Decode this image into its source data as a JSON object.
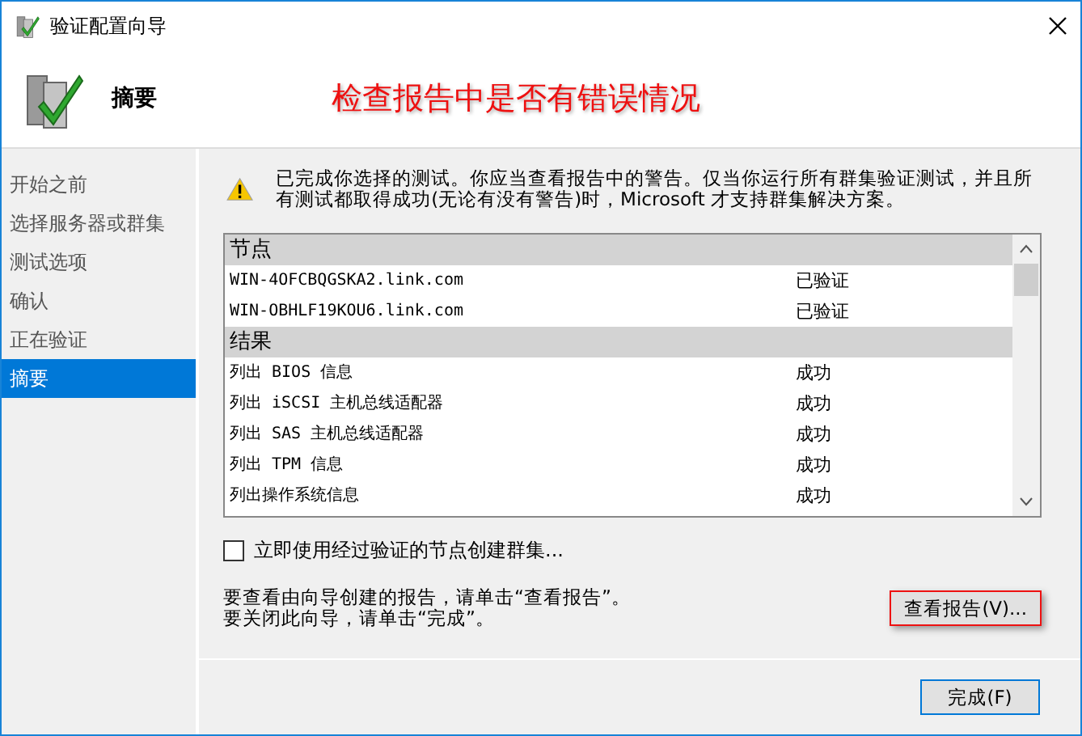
{
  "window": {
    "title": "验证配置向导"
  },
  "header": {
    "title": "摘要",
    "annotation": "检查报告中是否有错误情况"
  },
  "sidebar": {
    "items": [
      {
        "label": "开始之前",
        "selected": false
      },
      {
        "label": "选择服务器或群集",
        "selected": false
      },
      {
        "label": "测试选项",
        "selected": false
      },
      {
        "label": "确认",
        "selected": false
      },
      {
        "label": "正在验证",
        "selected": false
      },
      {
        "label": "摘要",
        "selected": true
      }
    ]
  },
  "message": "已完成你选择的测试。你应当查看报告中的警告。仅当你运行所有群集验证测试，并且所有测试都取得成功(无论有没有警告)时，Microsoft 才支持群集解决方案。",
  "report": {
    "sections": [
      {
        "title": "节点",
        "rows": [
          {
            "name": "WIN-4OFCBQGSKA2.link.com",
            "status": "已验证"
          },
          {
            "name": "WIN-OBHLF19KOU6.link.com",
            "status": "已验证"
          }
        ]
      },
      {
        "title": "结果",
        "rows": [
          {
            "name": "列出 BIOS 信息",
            "status": "成功"
          },
          {
            "name": "列出 iSCSI 主机总线适配器",
            "status": "成功"
          },
          {
            "name": "列出 SAS 主机总线适配器",
            "status": "成功"
          },
          {
            "name": "列出 TPM 信息",
            "status": "成功"
          },
          {
            "name": "列出操作系统信息",
            "status": "成功"
          }
        ]
      }
    ]
  },
  "create_cluster": {
    "label": "立即使用经过验证的节点创建群集...",
    "checked": false
  },
  "instructions": [
    "要查看由向导创建的报告，请单击“查看报告”。",
    "要关闭此向导，请单击“完成”。"
  ],
  "view_report_button": {
    "label": "查看报告(V)...",
    "highlighted": true
  },
  "finish_button": {
    "label": "完成(F)"
  }
}
